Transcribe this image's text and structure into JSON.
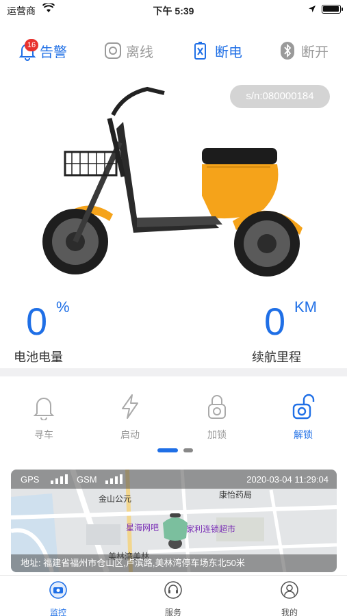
{
  "status_bar": {
    "carrier": "运营商",
    "time": "下午 5:39",
    "battery_level": 1.0
  },
  "states": {
    "alarm": {
      "label": "告警",
      "badge": "16"
    },
    "offline": {
      "label": "离线"
    },
    "power": {
      "label": "断电"
    },
    "bluetooth": {
      "label": "断开"
    }
  },
  "serial": "s/n:080000184",
  "stats": {
    "battery": {
      "value": "0",
      "unit": "%",
      "label": "电池电量"
    },
    "range": {
      "value": "0",
      "unit": "KM",
      "label": "续航里程"
    }
  },
  "actions": [
    {
      "label": "寻车",
      "icon": "bell-icon",
      "active": false
    },
    {
      "label": "启动",
      "icon": "lightning-icon",
      "active": false
    },
    {
      "label": "加锁",
      "icon": "lock-icon",
      "active": false
    },
    {
      "label": "解锁",
      "icon": "unlock-icon",
      "active": true
    }
  ],
  "pager": {
    "pages": 2,
    "current": 1
  },
  "map": {
    "gps_label": "GPS",
    "gsm_label": "GSM",
    "datetime": "2020-03-04 11:29:04",
    "address": "地址: 福建省福州市仓山区,卢滨路,美林湾停车场东北50米",
    "pois": [
      "金山公元",
      "康怡药局",
      "星海网吧",
      "家利连锁超市",
      "美林湾美林"
    ]
  },
  "tabs": [
    {
      "label": "监控",
      "icon": "monitor-icon",
      "active": true
    },
    {
      "label": "服务",
      "icon": "headset-icon",
      "active": false
    },
    {
      "label": "我的",
      "icon": "user-icon",
      "active": false
    }
  ],
  "colors": {
    "accent": "#1f6fe6",
    "inactive": "#9a9a9a",
    "badge": "#e8322e",
    "scooter": "#f5a31a"
  }
}
